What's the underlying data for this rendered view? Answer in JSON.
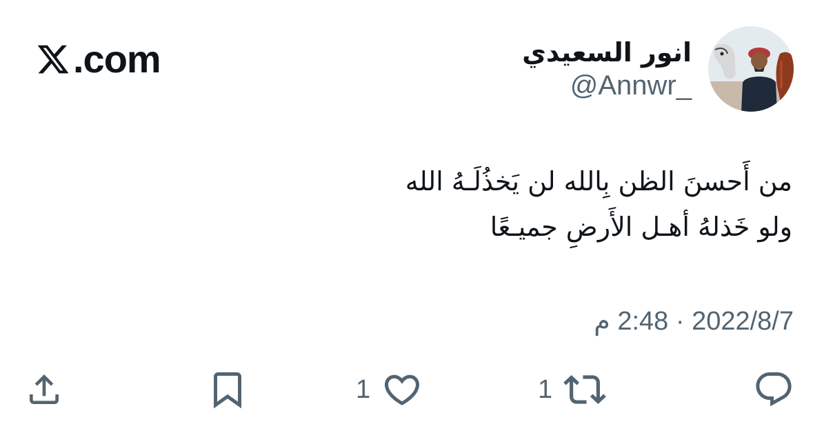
{
  "brand": {
    "domain": ".com",
    "icon": "x-logo-icon"
  },
  "author": {
    "display_name": "انور السعيدي",
    "handle": "@Annwr_",
    "avatar_icon": "avatar-photo"
  },
  "tweet": {
    "lines": [
      "من أَحسنَ الظن بِالله لن يَخذُلَـهُ الله",
      "ولو خَذلهُ أهـل الأَرضِ جميـعًا"
    ],
    "timestamp": "2022/8/7 · 2:48 م"
  },
  "actions": {
    "reply": {
      "icon": "reply-icon"
    },
    "retweet": {
      "icon": "retweet-icon",
      "count": "1"
    },
    "like": {
      "icon": "heart-icon",
      "count": "1"
    },
    "bookmark": {
      "icon": "bookmark-icon"
    },
    "share": {
      "icon": "share-icon"
    }
  },
  "colors": {
    "text": "#0f1419",
    "secondary": "#536471",
    "background": "#ffffff"
  }
}
